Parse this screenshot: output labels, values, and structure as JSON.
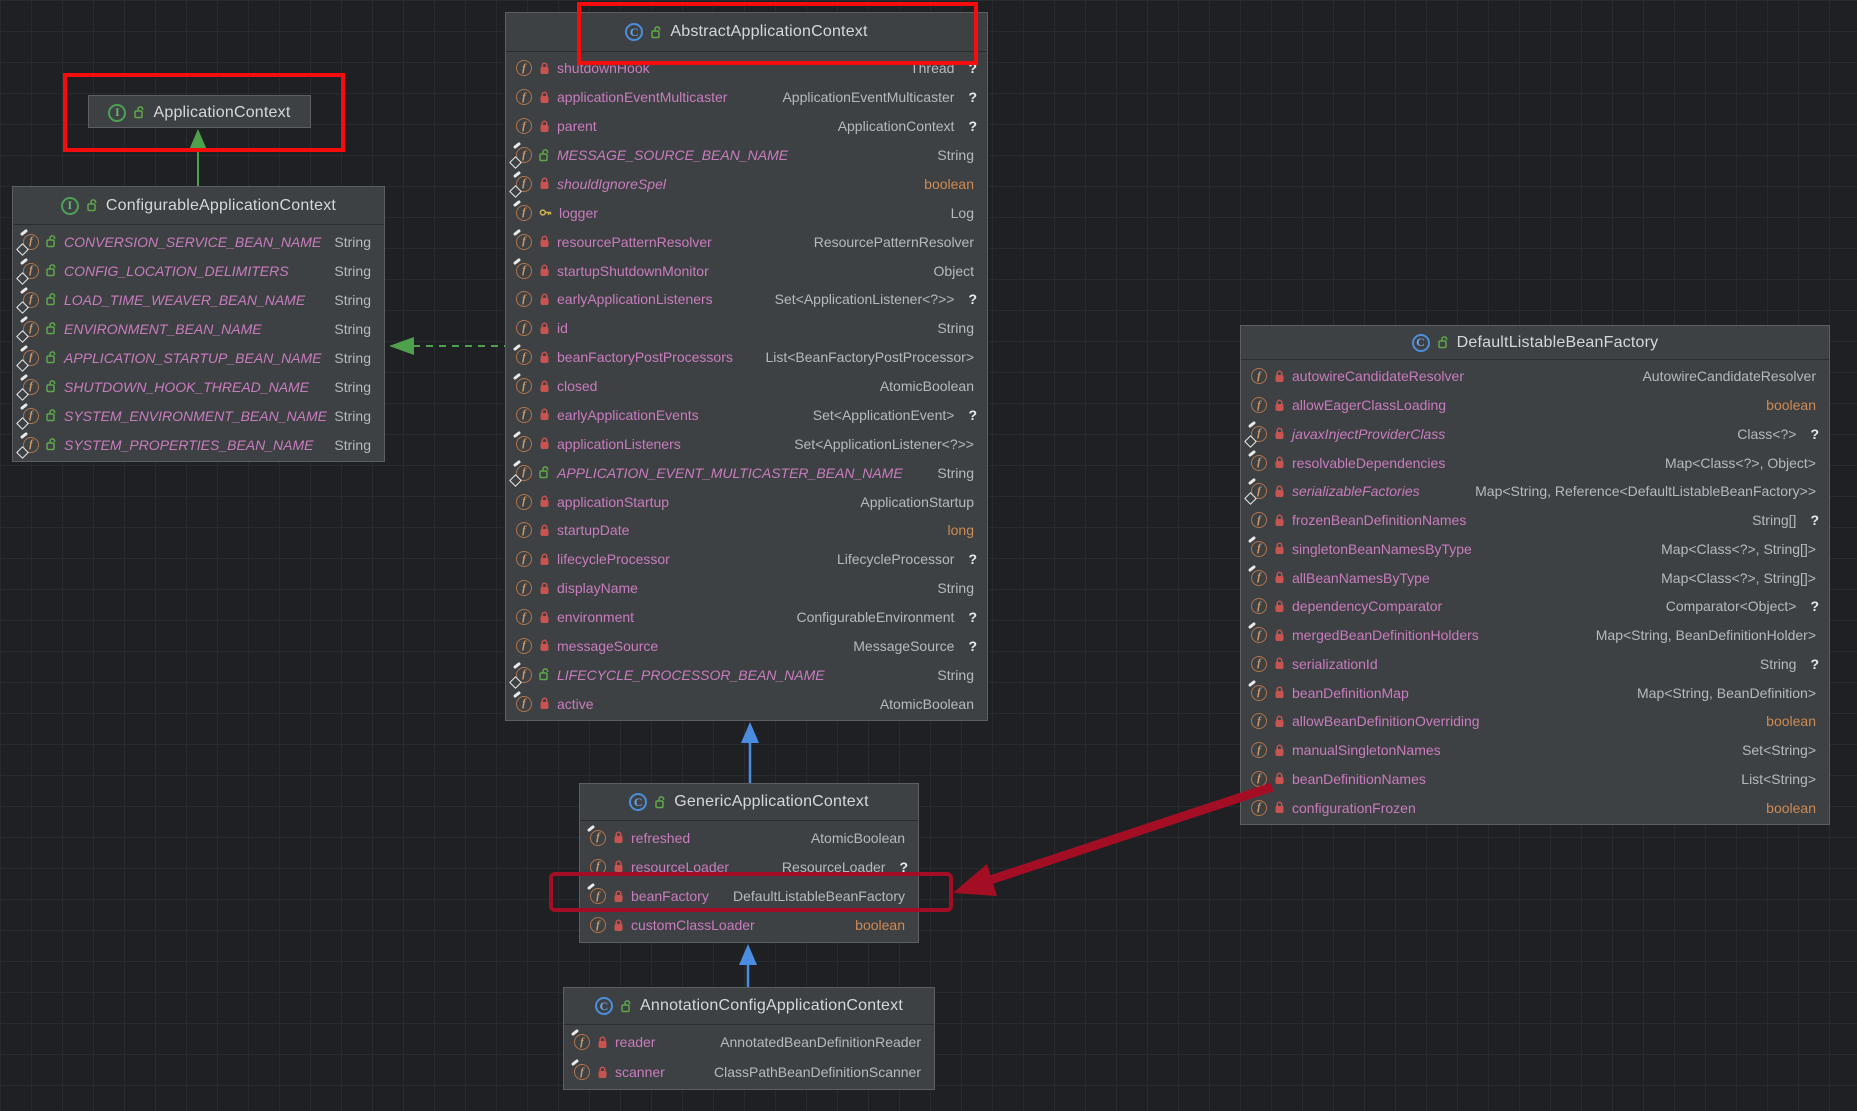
{
  "diagram": {
    "tool": "uml-class-diagram",
    "classes": [
      {
        "id": "application-context",
        "kind": "interface",
        "title": "ApplicationContext",
        "fields": []
      },
      {
        "id": "configurable-application-context",
        "kind": "interface",
        "title": "ConfigurableApplicationContext",
        "fields": [
          {
            "name": "CONVERSION_SERVICE_BEAN_NAME",
            "type": "String",
            "visibility": "public",
            "modifier": "staticfinal",
            "nullable": false,
            "primitive": false
          },
          {
            "name": "CONFIG_LOCATION_DELIMITERS",
            "type": "String",
            "visibility": "public",
            "modifier": "staticfinal",
            "nullable": false,
            "primitive": false
          },
          {
            "name": "LOAD_TIME_WEAVER_BEAN_NAME",
            "type": "String",
            "visibility": "public",
            "modifier": "staticfinal",
            "nullable": false,
            "primitive": false
          },
          {
            "name": "ENVIRONMENT_BEAN_NAME",
            "type": "String",
            "visibility": "public",
            "modifier": "staticfinal",
            "nullable": false,
            "primitive": false
          },
          {
            "name": "APPLICATION_STARTUP_BEAN_NAME",
            "type": "String",
            "visibility": "public",
            "modifier": "staticfinal",
            "nullable": false,
            "primitive": false
          },
          {
            "name": "SHUTDOWN_HOOK_THREAD_NAME",
            "type": "String",
            "visibility": "public",
            "modifier": "staticfinal",
            "nullable": false,
            "primitive": false
          },
          {
            "name": "SYSTEM_ENVIRONMENT_BEAN_NAME",
            "type": "String",
            "visibility": "public",
            "modifier": "staticfinal",
            "nullable": false,
            "primitive": false
          },
          {
            "name": "SYSTEM_PROPERTIES_BEAN_NAME",
            "type": "String",
            "visibility": "public",
            "modifier": "staticfinal",
            "nullable": false,
            "primitive": false
          }
        ]
      },
      {
        "id": "abstract-application-context",
        "kind": "class",
        "title": "AbstractApplicationContext",
        "fields": [
          {
            "name": "shutdownHook",
            "type": "Thread",
            "visibility": "private",
            "modifier": "plain",
            "nullable": true,
            "primitive": false
          },
          {
            "name": "applicationEventMulticaster",
            "type": "ApplicationEventMulticaster",
            "visibility": "private",
            "modifier": "plain",
            "nullable": true,
            "primitive": false
          },
          {
            "name": "parent",
            "type": "ApplicationContext",
            "visibility": "private",
            "modifier": "plain",
            "nullable": true,
            "primitive": false
          },
          {
            "name": "MESSAGE_SOURCE_BEAN_NAME",
            "type": "String",
            "visibility": "public",
            "modifier": "staticfinal",
            "nullable": false,
            "primitive": false
          },
          {
            "name": "shouldIgnoreSpel",
            "type": "boolean",
            "visibility": "private",
            "modifier": "staticfinal",
            "nullable": false,
            "primitive": true
          },
          {
            "name": "logger",
            "type": "Log",
            "visibility": "protected",
            "modifier": "final",
            "nullable": false,
            "primitive": false
          },
          {
            "name": "resourcePatternResolver",
            "type": "ResourcePatternResolver",
            "visibility": "private",
            "modifier": "final",
            "nullable": false,
            "primitive": false
          },
          {
            "name": "startupShutdownMonitor",
            "type": "Object",
            "visibility": "private",
            "modifier": "final",
            "nullable": false,
            "primitive": false
          },
          {
            "name": "earlyApplicationListeners",
            "type": "Set<ApplicationListener<?>>",
            "visibility": "private",
            "modifier": "plain",
            "nullable": true,
            "primitive": false
          },
          {
            "name": "id",
            "type": "String",
            "visibility": "private",
            "modifier": "plain",
            "nullable": false,
            "primitive": false
          },
          {
            "name": "beanFactoryPostProcessors",
            "type": "List<BeanFactoryPostProcessor>",
            "visibility": "private",
            "modifier": "final",
            "nullable": false,
            "primitive": false
          },
          {
            "name": "closed",
            "type": "AtomicBoolean",
            "visibility": "private",
            "modifier": "final",
            "nullable": false,
            "primitive": false
          },
          {
            "name": "earlyApplicationEvents",
            "type": "Set<ApplicationEvent>",
            "visibility": "private",
            "modifier": "plain",
            "nullable": true,
            "primitive": false
          },
          {
            "name": "applicationListeners",
            "type": "Set<ApplicationListener<?>>",
            "visibility": "private",
            "modifier": "final",
            "nullable": false,
            "primitive": false
          },
          {
            "name": "APPLICATION_EVENT_MULTICASTER_BEAN_NAME",
            "type": "String",
            "visibility": "public",
            "modifier": "staticfinal",
            "nullable": false,
            "primitive": false
          },
          {
            "name": "applicationStartup",
            "type": "ApplicationStartup",
            "visibility": "private",
            "modifier": "plain",
            "nullable": false,
            "primitive": false
          },
          {
            "name": "startupDate",
            "type": "long",
            "visibility": "private",
            "modifier": "plain",
            "nullable": false,
            "primitive": true
          },
          {
            "name": "lifecycleProcessor",
            "type": "LifecycleProcessor",
            "visibility": "private",
            "modifier": "plain",
            "nullable": true,
            "primitive": false
          },
          {
            "name": "displayName",
            "type": "String",
            "visibility": "private",
            "modifier": "plain",
            "nullable": false,
            "primitive": false
          },
          {
            "name": "environment",
            "type": "ConfigurableEnvironment",
            "visibility": "private",
            "modifier": "plain",
            "nullable": true,
            "primitive": false
          },
          {
            "name": "messageSource",
            "type": "MessageSource",
            "visibility": "private",
            "modifier": "plain",
            "nullable": true,
            "primitive": false
          },
          {
            "name": "LIFECYCLE_PROCESSOR_BEAN_NAME",
            "type": "String",
            "visibility": "public",
            "modifier": "staticfinal",
            "nullable": false,
            "primitive": false
          },
          {
            "name": "active",
            "type": "AtomicBoolean",
            "visibility": "private",
            "modifier": "final",
            "nullable": false,
            "primitive": false
          }
        ]
      },
      {
        "id": "default-listable-bean-factory",
        "kind": "class",
        "title": "DefaultListableBeanFactory",
        "fields": [
          {
            "name": "autowireCandidateResolver",
            "type": "AutowireCandidateResolver",
            "visibility": "private",
            "modifier": "plain",
            "nullable": false,
            "primitive": false
          },
          {
            "name": "allowEagerClassLoading",
            "type": "boolean",
            "visibility": "private",
            "modifier": "plain",
            "nullable": false,
            "primitive": true
          },
          {
            "name": "javaxInjectProviderClass",
            "type": "Class<?>",
            "visibility": "private",
            "modifier": "staticfinal",
            "nullable": true,
            "primitive": false
          },
          {
            "name": "resolvableDependencies",
            "type": "Map<Class<?>, Object>",
            "visibility": "private",
            "modifier": "final",
            "nullable": false,
            "primitive": false
          },
          {
            "name": "serializableFactories",
            "type": "Map<String, Reference<DefaultListableBeanFactory>>",
            "visibility": "private",
            "modifier": "staticfinal",
            "nullable": false,
            "primitive": false
          },
          {
            "name": "frozenBeanDefinitionNames",
            "type": "String[]",
            "visibility": "private",
            "modifier": "plain",
            "nullable": true,
            "primitive": false
          },
          {
            "name": "singletonBeanNamesByType",
            "type": "Map<Class<?>, String[]>",
            "visibility": "private",
            "modifier": "final",
            "nullable": false,
            "primitive": false
          },
          {
            "name": "allBeanNamesByType",
            "type": "Map<Class<?>, String[]>",
            "visibility": "private",
            "modifier": "final",
            "nullable": false,
            "primitive": false
          },
          {
            "name": "dependencyComparator",
            "type": "Comparator<Object>",
            "visibility": "private",
            "modifier": "plain",
            "nullable": true,
            "primitive": false
          },
          {
            "name": "mergedBeanDefinitionHolders",
            "type": "Map<String, BeanDefinitionHolder>",
            "visibility": "private",
            "modifier": "final",
            "nullable": false,
            "primitive": false
          },
          {
            "name": "serializationId",
            "type": "String",
            "visibility": "private",
            "modifier": "plain",
            "nullable": true,
            "primitive": false
          },
          {
            "name": "beanDefinitionMap",
            "type": "Map<String, BeanDefinition>",
            "visibility": "private",
            "modifier": "final",
            "nullable": false,
            "primitive": false
          },
          {
            "name": "allowBeanDefinitionOverriding",
            "type": "boolean",
            "visibility": "private",
            "modifier": "plain",
            "nullable": false,
            "primitive": true
          },
          {
            "name": "manualSingletonNames",
            "type": "Set<String>",
            "visibility": "private",
            "modifier": "plain",
            "nullable": false,
            "primitive": false
          },
          {
            "name": "beanDefinitionNames",
            "type": "List<String>",
            "visibility": "private",
            "modifier": "plain",
            "nullable": false,
            "primitive": false
          },
          {
            "name": "configurationFrozen",
            "type": "boolean",
            "visibility": "private",
            "modifier": "plain",
            "nullable": false,
            "primitive": true
          }
        ]
      },
      {
        "id": "generic-application-context",
        "kind": "class",
        "title": "GenericApplicationContext",
        "fields": [
          {
            "name": "refreshed",
            "type": "AtomicBoolean",
            "visibility": "private",
            "modifier": "final",
            "nullable": false,
            "primitive": false
          },
          {
            "name": "resourceLoader",
            "type": "ResourceLoader",
            "visibility": "private",
            "modifier": "plain",
            "nullable": true,
            "primitive": false
          },
          {
            "name": "beanFactory",
            "type": "DefaultListableBeanFactory",
            "visibility": "private",
            "modifier": "final",
            "nullable": false,
            "primitive": false
          },
          {
            "name": "customClassLoader",
            "type": "boolean",
            "visibility": "private",
            "modifier": "plain",
            "nullable": false,
            "primitive": true
          }
        ]
      },
      {
        "id": "annotation-config-application-context",
        "kind": "class",
        "title": "AnnotationConfigApplicationContext",
        "fields": [
          {
            "name": "reader",
            "type": "AnnotatedBeanDefinitionReader",
            "visibility": "private",
            "modifier": "final",
            "nullable": false,
            "primitive": false
          },
          {
            "name": "scanner",
            "type": "ClassPathBeanDefinitionScanner",
            "visibility": "private",
            "modifier": "final",
            "nullable": false,
            "primitive": false
          }
        ]
      }
    ],
    "edges": [
      {
        "id": "extends-configurable-to-applicationcontext",
        "style": "solid",
        "color_key": "green"
      },
      {
        "id": "implements-abstract-to-configurable",
        "style": "dashed",
        "color_key": "green"
      },
      {
        "id": "extends-generic-to-abstract",
        "style": "solid",
        "color_key": "blue"
      },
      {
        "id": "extends-annotationconfig-to-generic",
        "style": "solid",
        "color_key": "blue"
      }
    ],
    "annotations": [
      {
        "id": "red-rect-application-context",
        "color_key": "red"
      },
      {
        "id": "red-rect-abstract-header",
        "color_key": "red"
      },
      {
        "id": "crimson-rect-beanfactory-row",
        "color_key": "crimson"
      },
      {
        "id": "crimson-arrow-factory-to-beanfactory",
        "color_key": "crimson"
      }
    ],
    "colors": {
      "red": "#f50c0c",
      "crimson": "#a30e24",
      "green": "#4fa04d",
      "blue": "#4a8de0",
      "field_name_pink": "#c87cbe",
      "type_gray": "#b5bac0",
      "primitive_orange": "#cd8a54",
      "box_bg": "#3e4143"
    }
  }
}
